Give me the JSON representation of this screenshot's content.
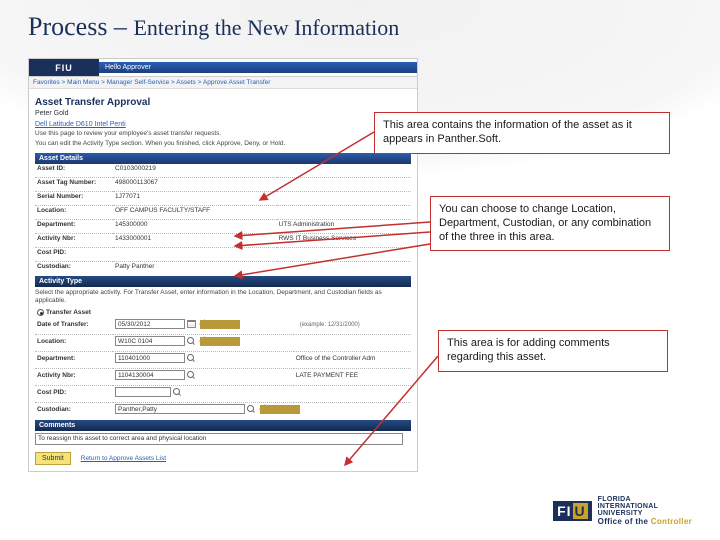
{
  "slide": {
    "title_a": "Process – ",
    "title_b": "Entering the New Information"
  },
  "brand": {
    "fiu": "FIU",
    "hello": "Hello Approver"
  },
  "crumbs": {
    "a": "Favorites",
    "b": "Main Menu",
    "c": "Manager Self-Service",
    "d": "Assets",
    "e": "Approve Asset Transfer",
    "sep": " > "
  },
  "page": {
    "title": "Asset Transfer Approval",
    "name": "Peter Gold",
    "asset_link": "Dell Latitude D610 Intel Penti",
    "intro1": "Use this page to review your employee's asset transfer requests.",
    "intro2": "You can edit the Activity Type section. When you finished, click Approve, Deny, or Hold."
  },
  "sections": {
    "details": "Asset Details",
    "activity": "Activity Type",
    "comments": "Comments"
  },
  "details": {
    "asset_id_lbl": "Asset ID:",
    "asset_id": "C0103000219",
    "tag_lbl": "Asset Tag Number:",
    "tag": "498000113067",
    "serial_lbl": "Serial Number:",
    "serial": "1J77071",
    "loc_lbl": "Location:",
    "loc": "OFF CAMPUS FACULTY/STAFF",
    "dept_lbl": "Department:",
    "dept": "145300000",
    "dept_desc": "UTS Administration",
    "act_lbl": "Activity Nbr:",
    "act": "1433000001",
    "act_desc": "RWS IT Business Services",
    "cpid_lbl": "Cost PID:",
    "cpid": "",
    "cust_lbl": "Custodian:",
    "cust": "Patty Panther"
  },
  "activity": {
    "intro": "Select the appropriate activity. For Transfer Asset, enter information in the Location, Department, and Custodian fields as applicable.",
    "radio_lbl": "Transfer Asset",
    "date_lbl": "Date of Transfer:",
    "date": "05/30/2012",
    "date_ex": "(example: 12/31/2000)",
    "loc_lbl": "Location:",
    "loc": "W10C 0104",
    "dept_lbl": "Department:",
    "dept": "110401000",
    "dept_desc": "Office of the Controller Adm",
    "act_lbl": "Activity Nbr:",
    "act": "1104130004",
    "act_desc": "LATE PAYMENT FEE",
    "cpid_lbl": "Cost PID:",
    "cust_lbl": "Custodian:",
    "cust": "Panther,Patty"
  },
  "comments": {
    "text": "To reassign this asset to correct area and physical location"
  },
  "submit": "Submit",
  "return_link": "Return to Approve Assets List",
  "callouts": {
    "c1": "This area contains the information of the asset as it appears in Panther.Soft.",
    "c2": "You can choose to change Location, Department, Custodian, or any combination of the three in this area.",
    "c3": "This area is for adding comments regarding this asset."
  },
  "footer": {
    "uni1": "FLORIDA",
    "uni2": "INTERNATIONAL",
    "uni3": "UNIVERSITY",
    "office_a": "Office of the ",
    "office_b": "Controller"
  }
}
